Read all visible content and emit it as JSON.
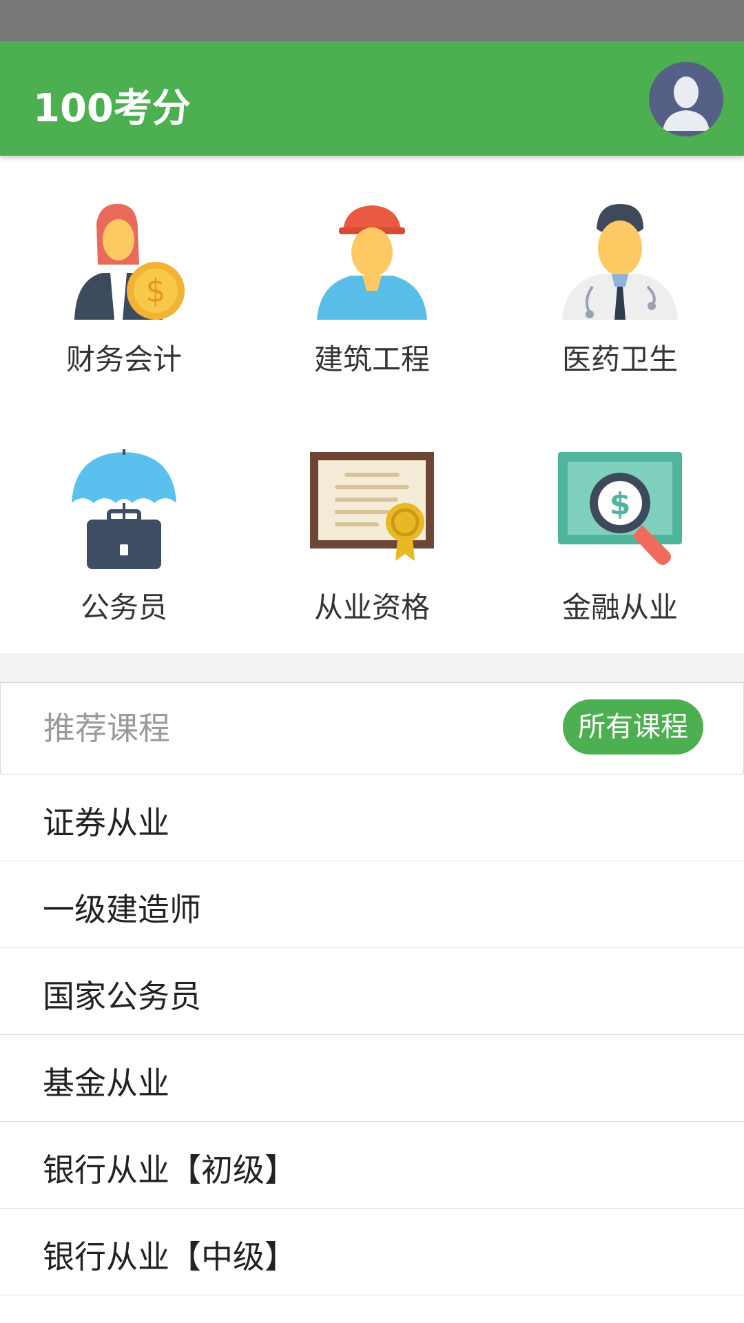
{
  "app_bar": {
    "title": "100考分",
    "avatar_icon": "user-avatar-icon"
  },
  "categories": [
    {
      "label": "财务会计",
      "icon": "accountant-icon"
    },
    {
      "label": "建筑工程",
      "icon": "construction-worker-icon"
    },
    {
      "label": "医药卫生",
      "icon": "doctor-icon"
    },
    {
      "label": "公务员",
      "icon": "umbrella-briefcase-icon"
    },
    {
      "label": "从业资格",
      "icon": "certificate-icon"
    },
    {
      "label": "金融从业",
      "icon": "money-magnifier-icon"
    }
  ],
  "recommended": {
    "title": "推荐课程",
    "all_button": "所有课程"
  },
  "courses": [
    "证券从业",
    "一级建造师",
    "国家公务员",
    "基金从业",
    "银行从业【初级】",
    "银行从业【中级】"
  ],
  "colors": {
    "primary": "#4caf50",
    "status_bar": "#777777",
    "avatar_bg": "#566086"
  }
}
